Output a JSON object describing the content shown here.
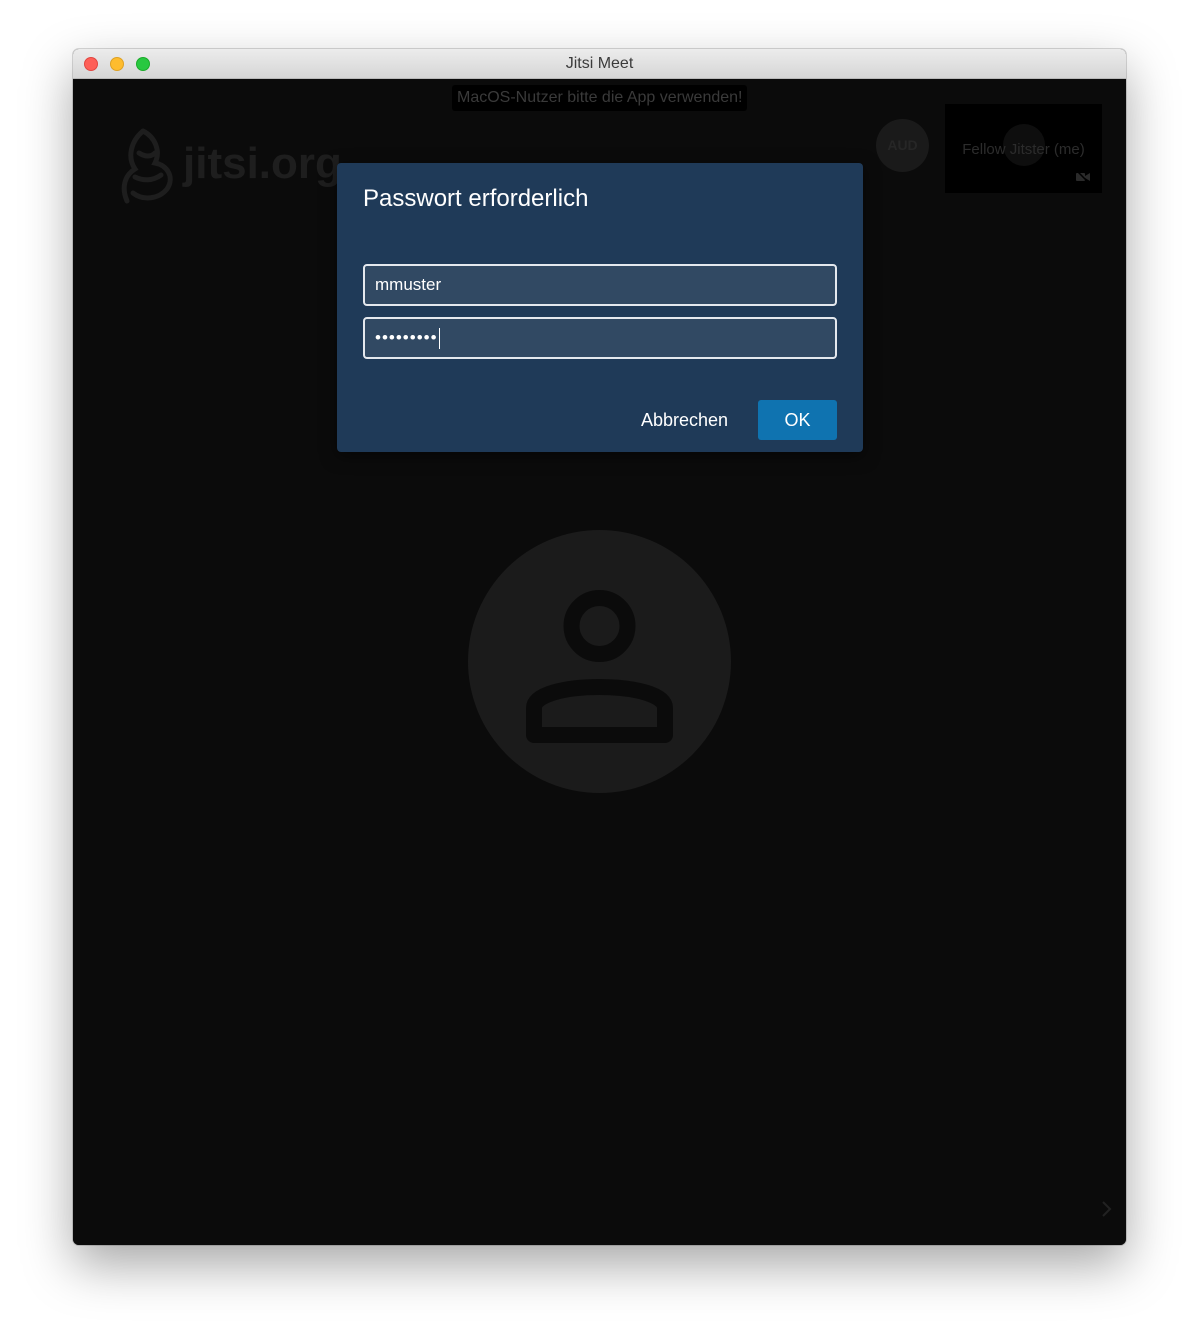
{
  "window": {
    "title": "Jitsi Meet"
  },
  "conference": {
    "notice": "MacOS-Nutzer bitte die App verwenden!",
    "watermark_text": "jitsi.org",
    "audio_badge": "AUD",
    "local_participant_name": "Fellow Jitster (me)",
    "icons": {
      "watermark": "jitsi-logo-icon",
      "avatar": "user-avatar-icon",
      "camera_off": "video-off-icon",
      "chevron": "chevron-right-icon"
    }
  },
  "dialog": {
    "title": "Passwort erforderlich",
    "username_value": "mmuster",
    "password_value": "•••••••••",
    "cancel_label": "Abbrechen",
    "ok_label": "OK",
    "colors": {
      "background": "#1f3a58",
      "ok_button": "#0f73b0"
    }
  }
}
